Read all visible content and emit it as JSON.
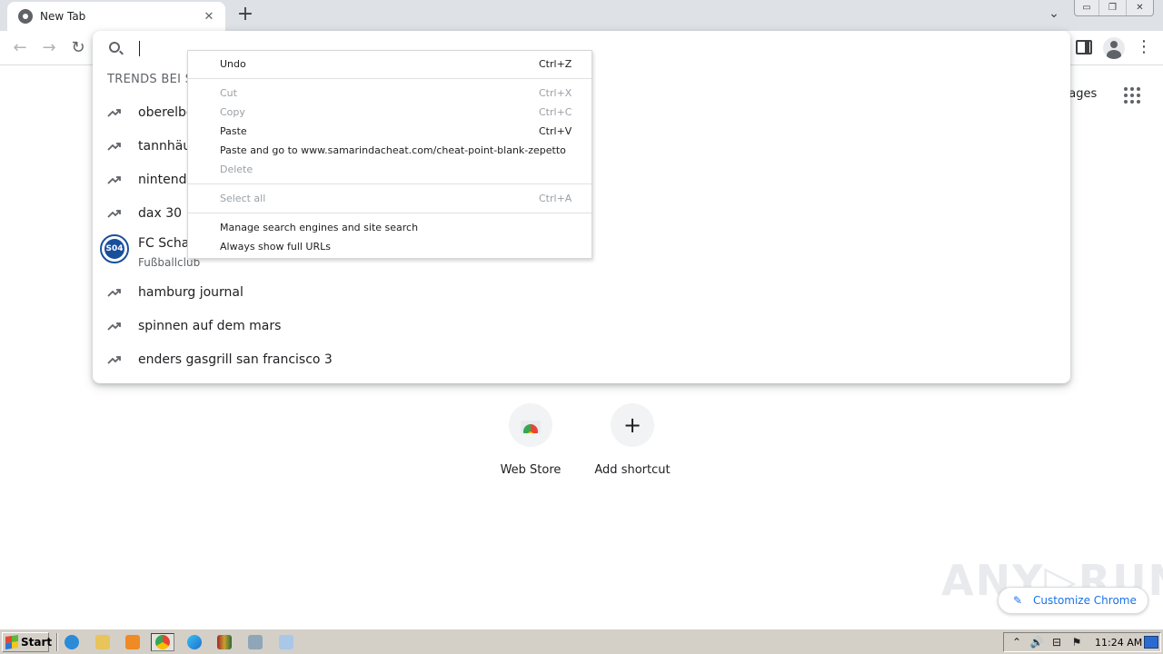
{
  "window": {
    "tab_title": "New Tab",
    "tab_close_glyph": "✕",
    "new_tab_glyph": "+",
    "tab_search_glyph": "⌄",
    "minimize_glyph": "▭",
    "restore_glyph": "❐",
    "close_glyph": "✕"
  },
  "toolbar": {
    "back_glyph": "←",
    "forward_glyph": "→",
    "reload_glyph": "↻",
    "menu_glyph": "⋮"
  },
  "omnibox": {
    "heading": "TRENDS BEI S",
    "suggestions": [
      {
        "text": "oberelbe",
        "icon": "trending-icon"
      },
      {
        "text": "tannhäus",
        "icon": "trending-icon"
      },
      {
        "text": "nintendo",
        "icon": "trending-icon"
      },
      {
        "text": "dax 30",
        "icon": "trending-icon"
      },
      {
        "text": "FC Schal",
        "subtitle": "Fußballclub",
        "icon": "schalke-logo",
        "logo_text": "S04"
      },
      {
        "text": "hamburg journal",
        "icon": "trending-icon"
      },
      {
        "text": "spinnen auf dem mars",
        "icon": "trending-icon"
      },
      {
        "text": "enders gasgrill san francisco 3",
        "icon": "trending-icon"
      }
    ]
  },
  "context_menu": {
    "items": [
      {
        "label": "Undo",
        "shortcut": "Ctrl+Z",
        "enabled": true
      },
      {
        "label": "Cut",
        "shortcut": "Ctrl+X",
        "enabled": false
      },
      {
        "label": "Copy",
        "shortcut": "Ctrl+C",
        "enabled": false
      },
      {
        "label": "Paste",
        "shortcut": "Ctrl+V",
        "enabled": true
      },
      {
        "label": "Paste and go to www.samarindacheat.com/cheat-point-blank-zepetto",
        "shortcut": "",
        "enabled": true
      },
      {
        "label": "Delete",
        "shortcut": "",
        "enabled": false
      },
      {
        "label": "Select all",
        "shortcut": "Ctrl+A",
        "enabled": false
      },
      {
        "label": "Manage search engines and site search",
        "shortcut": "",
        "enabled": true
      },
      {
        "label": "Always show full URLs",
        "shortcut": "",
        "enabled": true
      }
    ]
  },
  "page": {
    "images_link": "nages",
    "shortcuts": [
      {
        "label": "Web Store"
      },
      {
        "label": "Add shortcut",
        "glyph": "+"
      }
    ],
    "customize_label": "Customize Chrome",
    "pencil_glyph": "✎",
    "watermark": "ANY▷RUN"
  },
  "taskbar": {
    "start_label": "Start",
    "clock": "11:24 AM",
    "tray_glyphs": [
      "⌃",
      "🔊",
      "⊟",
      "⚑"
    ]
  },
  "colors": {
    "accent": "#1a73e8",
    "tab_strip": "#dee1e6",
    "taskbar": "#d4d0c8"
  }
}
